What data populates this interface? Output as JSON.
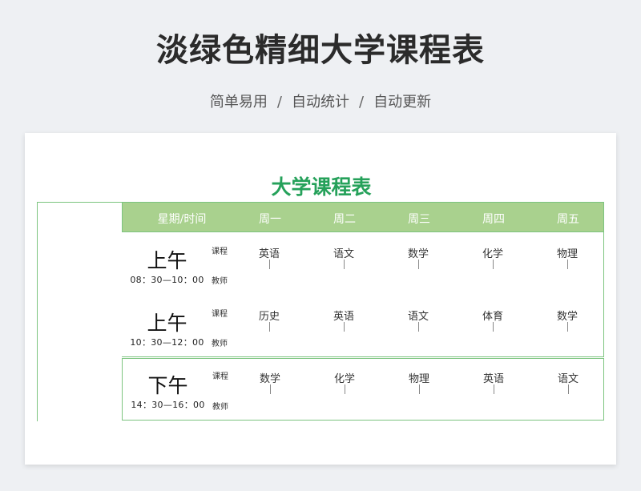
{
  "page": {
    "title": "淡绿色精细大学课程表",
    "subtitle_parts": [
      "简单易用",
      "自动统计",
      "自动更新"
    ],
    "separator": "/"
  },
  "timetable": {
    "title": "大学课程表",
    "header": [
      "星期/时间",
      "周一",
      "周二",
      "周三",
      "周四",
      "周五"
    ],
    "course_label": "课程",
    "teacher_label": "教师",
    "sessions": [
      {
        "period": "上午",
        "time": "08：30—10：00",
        "courses": [
          "英语",
          "语文",
          "数学",
          "化学",
          "物理"
        ]
      },
      {
        "period": "上午",
        "time": "10：30—12：00",
        "courses": [
          "历史",
          "英语",
          "语文",
          "体育",
          "数学"
        ]
      },
      {
        "period": "下午",
        "time": "14：30—16：00",
        "courses": [
          "数学",
          "化学",
          "物理",
          "英语",
          "语文"
        ]
      }
    ]
  },
  "colors": {
    "accent_green": "#25a15a",
    "header_fill": "#a9d18e",
    "border_green": "#7cc47f",
    "background": "#eef0f3"
  }
}
